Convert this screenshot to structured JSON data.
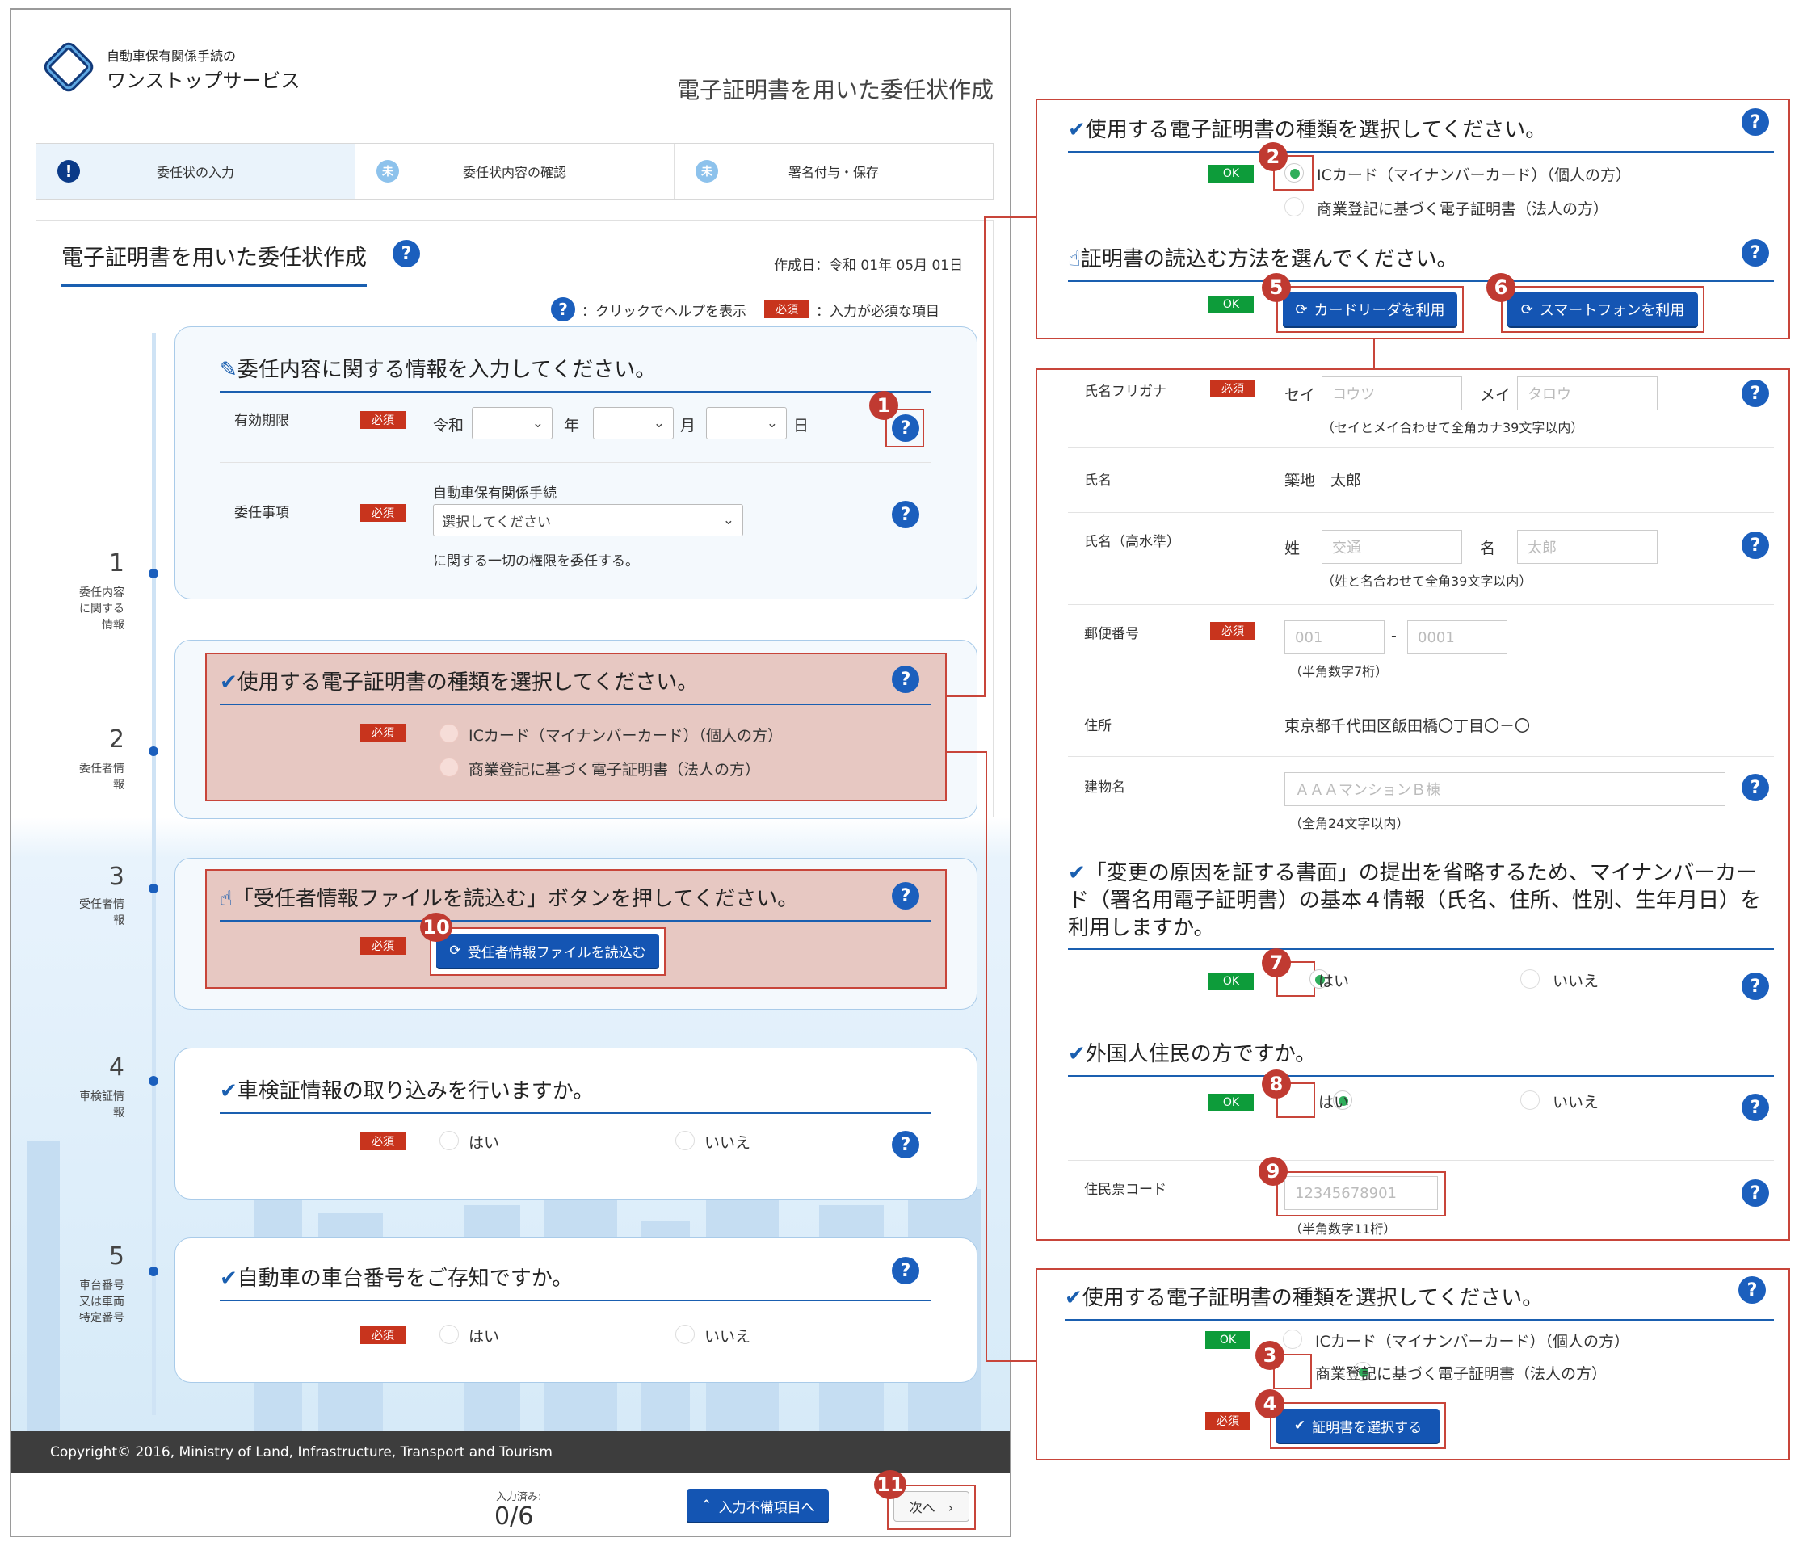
{
  "header": {
    "logo_small": "自動車保有関係手続の",
    "logo_big": "ワンストップサービス",
    "page_title": "電子証明書を用いた委任状作成"
  },
  "steps": [
    {
      "label": "委任状の入力",
      "badge": "!"
    },
    {
      "label": "委任状内容の確認",
      "badge": "未"
    },
    {
      "label": "署名付与・保存",
      "badge": "未"
    }
  ],
  "form": {
    "title": "電子証明書を用いた委任状作成",
    "created": "作成日：令和 01年 05月 01日",
    "legend_help": "：クリックでヘルプを表示",
    "legend_req": "：入力が必須な項目",
    "req_label": "必須",
    "ok_label": "OK",
    "help_glyph": "?",
    "sections": [
      {
        "num": "1",
        "label": "委任内容\nに関する\n情報"
      },
      {
        "num": "2",
        "label": "委任者情\n報"
      },
      {
        "num": "3",
        "label": "受任者情\n報"
      },
      {
        "num": "4",
        "label": "車検証情\n報"
      },
      {
        "num": "5",
        "label": "車台番号\n又は車両\n特定番号"
      }
    ],
    "s1": {
      "title": "委任内容に関する情報を入力してください。",
      "expiry_label": "有効期限",
      "era": "令和",
      "year": "年",
      "month": "月",
      "day": "日",
      "matter_label": "委任事項",
      "matter_prefix": "自動車保有関係手続",
      "matter_select": "選択してください",
      "matter_suffix": "に関する一切の権限を委任する。"
    },
    "s2": {
      "title": "使用する電子証明書の種類を選択してください。",
      "opt1": "ICカード（マイナンバーカード）（個人の方）",
      "opt2": "商業登記に基づく電子証明書（法人の方）"
    },
    "s3": {
      "title": "「受任者情報ファイルを読込む」ボタンを押してください。",
      "button": "受任者情報ファイルを読込む"
    },
    "s4": {
      "title": "車検証情報の取り込みを行いますか。",
      "yes": "はい",
      "no": "いいえ"
    },
    "s5": {
      "title": "自動車の車台番号をご存知ですか。",
      "yes": "はい",
      "no": "いいえ"
    }
  },
  "footer": {
    "copyright": "Copyright© 2016, Ministry of Land, Infrastructure, Transport and Tourism",
    "progress_label": "入力済み:",
    "progress": "0/6",
    "missing_button": "入力不備項目へ",
    "next_button": "次へ　›"
  },
  "callouts": {
    "c1": "1",
    "c2": "2",
    "c3": "3",
    "c4": "4",
    "c5": "5",
    "c6": "6",
    "c7": "7",
    "c8": "8",
    "c9": "9",
    "c10": "10",
    "c11": "11"
  },
  "right_top": {
    "title": "使用する電子証明書の種類を選択してください。",
    "opt1": "ICカード（マイナンバーカード）（個人の方）",
    "opt2": "商業登記に基づく電子証明書（法人の方）",
    "read_title": "証明書の読込む方法を選んでください。",
    "card_reader": "カードリーダを利用",
    "smartphone": "スマートフォンを利用"
  },
  "right_mid": {
    "kana_label": "氏名フリガナ",
    "sei": "セイ",
    "sei_ph": "コウツ",
    "mei": "メイ",
    "mei_ph": "タロウ",
    "kana_note": "（セイとメイ合わせて全角カナ39文字以内）",
    "name_label": "氏名",
    "name_value": "築地　太郎",
    "hname_label": "氏名（高水準）",
    "sei2": "姓",
    "sei2_ph": "交通",
    "mei2": "名",
    "mei2_ph": "太郎",
    "hname_note": "（姓と名合わせて全角39文字以内）",
    "zip_label": "郵便番号",
    "zip1_ph": "001",
    "zip_dash": "-",
    "zip2_ph": "0001",
    "zip_note": "（半角数字7桁）",
    "addr_label": "住所",
    "addr_value": "東京都千代田区飯田橋〇丁目〇－〇",
    "bldg_label": "建物名",
    "bldg_ph": "ＡＡＡマンションＢ棟",
    "bldg_note": "（全角24文字以内）",
    "q1": "「変更の原因を証する書面」の提出を省略するため、マイナンバーカード（署名用電子証明書）の基本４情報（氏名、住所、性別、生年月日）を利用しますか。",
    "yes": "はい",
    "no": "いいえ",
    "q2": "外国人住民の方ですか。",
    "jumin_label": "住民票コード",
    "jumin_ph": "12345678901",
    "jumin_note": "（半角数字11桁）"
  },
  "right_bottom": {
    "title": "使用する電子証明書の種類を選択してください。",
    "opt1": "ICカード（マイナンバーカード）（個人の方）",
    "opt2": "商業登記に基づく電子証明書（法人の方）",
    "button": "証明書を選択する"
  }
}
